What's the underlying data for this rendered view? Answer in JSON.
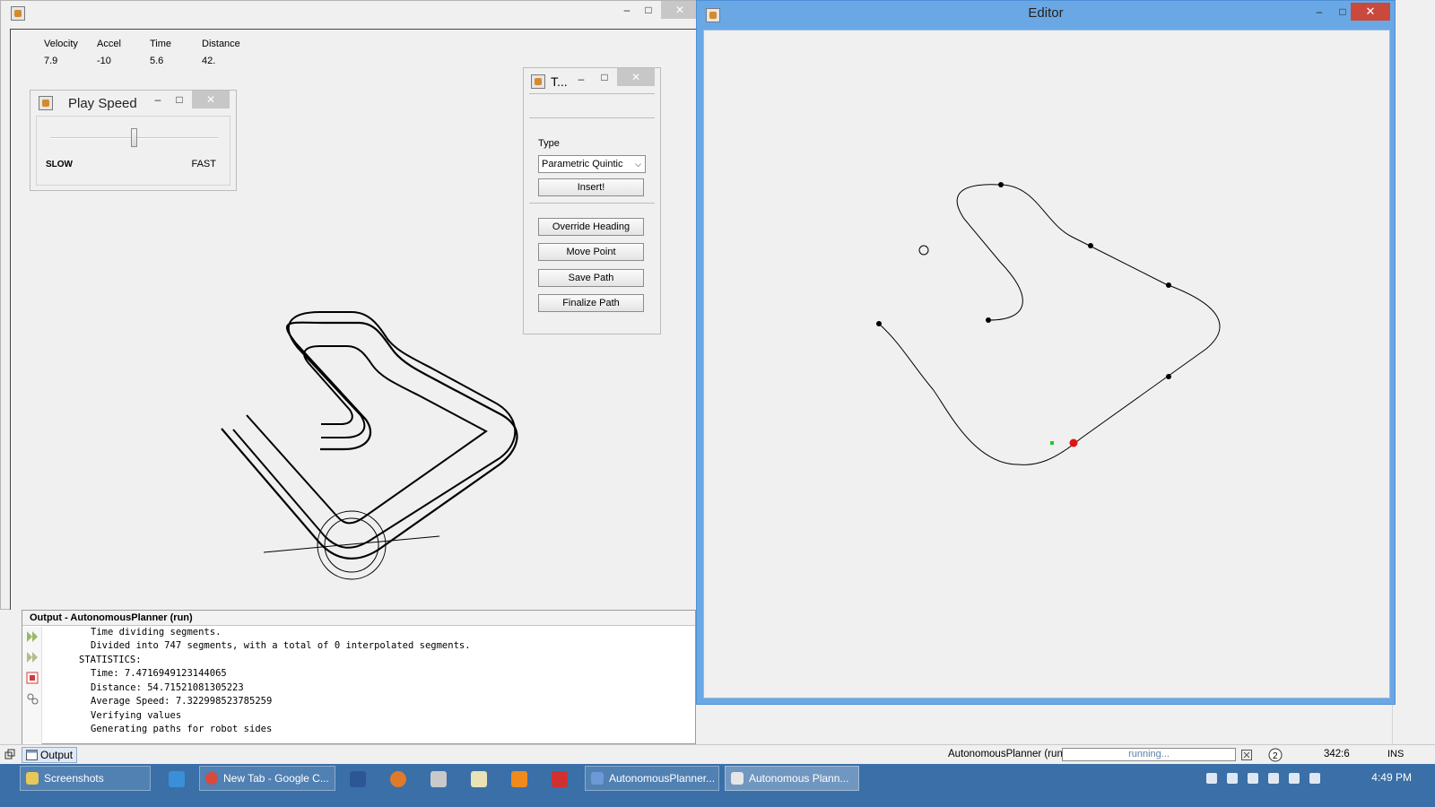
{
  "stats": {
    "headers": [
      "Velocity",
      "Accel",
      "Time",
      "Distance"
    ],
    "values": [
      "7.9",
      "-10",
      "5.6",
      "42."
    ]
  },
  "play_speed": {
    "title": "Play Speed",
    "slow_label": "SLOW",
    "fast_label": "FAST",
    "slider_fraction": 0.5
  },
  "tools": {
    "title": "T...",
    "type_label": "Type",
    "type_value": "Parametric Quintic",
    "insert_label": "Insert!",
    "override_label": "Override Heading",
    "move_label": "Move Point",
    "save_label": "Save Path",
    "finalize_label": "Finalize Path"
  },
  "editor": {
    "title": "Editor"
  },
  "output": {
    "header": "Output - AutonomousPlanner (run)",
    "lines": [
      "Time dividing segments.",
      "Divided into 747 segments, with a total of 0 interpolated segments.",
      "STATISTICS:",
      "Time: 7.4716949123144065",
      "Distance: 54.71521081305223",
      "Average Speed: 7.322998523785259",
      "Verifying values",
      "Generating paths for robot sides"
    ]
  },
  "status": {
    "output_tab": "Output",
    "project": "AutonomousPlanner (run)",
    "progress_text": "running...",
    "cursor": "342:6",
    "ins": "INS"
  },
  "taskbar": {
    "items": [
      "Screenshots",
      "New Tab - Google C...",
      "AutonomousPlanner...",
      "Autonomous Plann..."
    ],
    "clock": "4:49 PM"
  }
}
